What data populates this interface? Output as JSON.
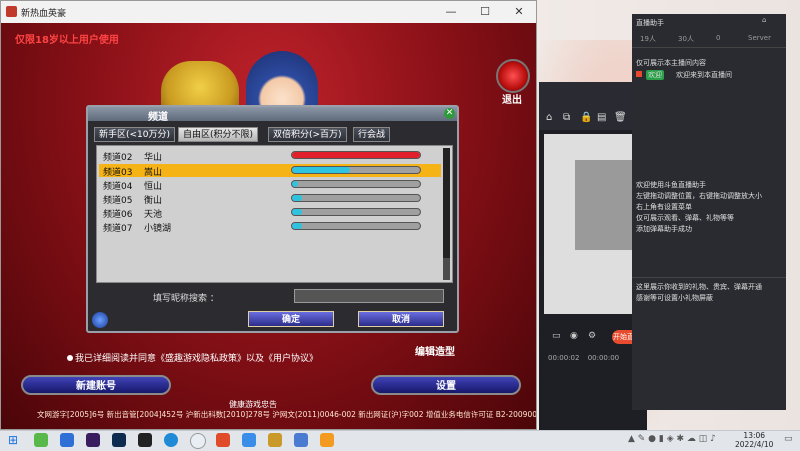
{
  "game_window": {
    "title": "新热血英豪",
    "min": "—",
    "max": "☐",
    "close": "✕"
  },
  "game": {
    "age_warning": "仅限18岁以上用户使用",
    "exit_label": "退出",
    "edit_label": "编辑造型",
    "new_account": "新建账号",
    "settings": "设置",
    "agree_text": "我已详细阅读并同意《盛趣游戏隐私政策》以及《用户协议》",
    "tip_line": "健康游戏忠告",
    "license_text": "文网游字[2005]6号 新出音管[2004]452号 沪新出科数[2010]278号 沪网文(2011)0046-002 新出网证(沪)字002 增值业务电信许可证 B2-20090046"
  },
  "dialog": {
    "title": "频道",
    "tabs": [
      "新手区(<10万分)",
      "自由区(积分不限)",
      "双倍积分(>百万)",
      "行会战"
    ],
    "active_tab": 1,
    "channels": [
      {
        "name": "频道02",
        "line": "华山",
        "load": 1.0,
        "color": "#e0202a"
      },
      {
        "name": "频道03",
        "line": "嵩山",
        "load": 0.45,
        "color": "#2ec4e0"
      },
      {
        "name": "频道04",
        "line": "恒山",
        "load": 0.05,
        "color": "#2ec4e0"
      },
      {
        "name": "频道05",
        "line": "衡山",
        "load": 0.08,
        "color": "#2ec4e0"
      },
      {
        "name": "频道06",
        "line": "天池",
        "load": 0.08,
        "color": "#2ec4e0"
      },
      {
        "name": "频道07",
        "line": "小镜湖",
        "load": 0.08,
        "color": "#2ec4e0"
      }
    ],
    "selected_index": 1,
    "search_label": "填写昵称搜索 ：",
    "search_value": "",
    "ok": "确定",
    "cancel": "取消"
  },
  "middle_app": {
    "ts_left": "00:00:02",
    "ts_right": "00:00:00",
    "live_btn": "开始直播"
  },
  "right_panel": {
    "header": "直播助手",
    "stats": [
      "19人",
      "30人",
      "0",
      "Server"
    ],
    "intro": "仅可展示本主播间内容",
    "welcome_badge": "欢迎",
    "welcome": "欢迎来到本直播间",
    "msg_lines": [
      "欢迎使用斗鱼直播助手",
      "左键拖动调整位置，右键拖动调整放大小",
      "右上角有设置菜单",
      "仅可展示观看、弹幕、礼物等等",
      "添加弹幕助手成功"
    ],
    "gift_lines": [
      "这里展示你收到的礼物、贵宾、弹幕开通",
      "感谢等可设置小礼物屏蔽"
    ]
  },
  "taskbar": {
    "time": "13:06",
    "date": "2022/4/10"
  }
}
